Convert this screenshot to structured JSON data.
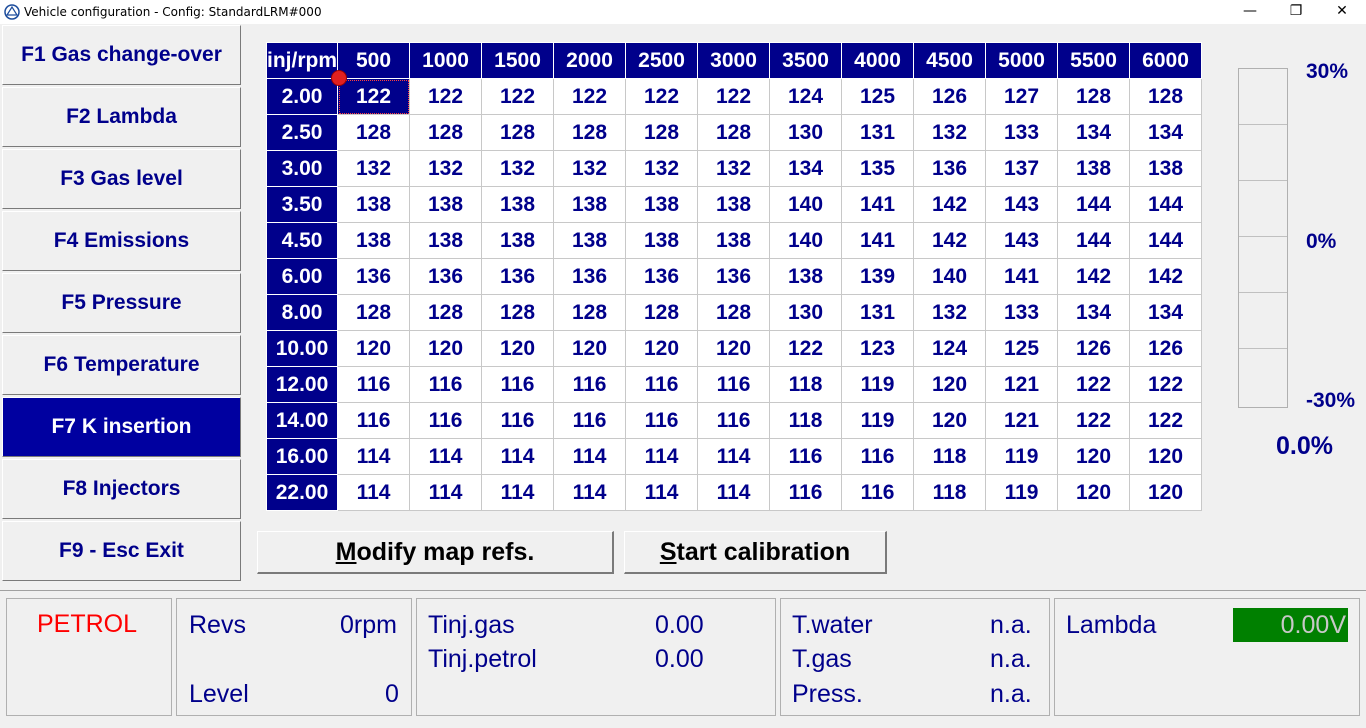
{
  "window": {
    "title": "Vehicle configuration - Config: StandardLRM#000",
    "minimize": "—",
    "maximize": "❐",
    "close": "✕"
  },
  "sidebar": {
    "items": [
      {
        "label": "F1 Gas change-over"
      },
      {
        "label": "F2 Lambda"
      },
      {
        "label": "F3 Gas level"
      },
      {
        "label": "F4 Emissions"
      },
      {
        "label": "F5 Pressure"
      },
      {
        "label": "F6 Temperature"
      },
      {
        "label": "F7 K insertion"
      },
      {
        "label": "F8 Injectors"
      },
      {
        "label": "F9 - Esc Exit"
      }
    ],
    "active_index": 6
  },
  "map": {
    "corner": "inj/rpm",
    "columns": [
      "500",
      "1000",
      "1500",
      "2000",
      "2500",
      "3000",
      "3500",
      "4000",
      "4500",
      "5000",
      "5500",
      "6000"
    ],
    "rows": [
      {
        "label": "2.00",
        "values": [
          "122",
          "122",
          "122",
          "122",
          "122",
          "122",
          "124",
          "125",
          "126",
          "127",
          "128",
          "128"
        ]
      },
      {
        "label": "2.50",
        "values": [
          "128",
          "128",
          "128",
          "128",
          "128",
          "128",
          "130",
          "131",
          "132",
          "133",
          "134",
          "134"
        ]
      },
      {
        "label": "3.00",
        "values": [
          "132",
          "132",
          "132",
          "132",
          "132",
          "132",
          "134",
          "135",
          "136",
          "137",
          "138",
          "138"
        ]
      },
      {
        "label": "3.50",
        "values": [
          "138",
          "138",
          "138",
          "138",
          "138",
          "138",
          "140",
          "141",
          "142",
          "143",
          "144",
          "144"
        ]
      },
      {
        "label": "4.50",
        "values": [
          "138",
          "138",
          "138",
          "138",
          "138",
          "138",
          "140",
          "141",
          "142",
          "143",
          "144",
          "144"
        ]
      },
      {
        "label": "6.00",
        "values": [
          "136",
          "136",
          "136",
          "136",
          "136",
          "136",
          "138",
          "139",
          "140",
          "141",
          "142",
          "142"
        ]
      },
      {
        "label": "8.00",
        "values": [
          "128",
          "128",
          "128",
          "128",
          "128",
          "128",
          "130",
          "131",
          "132",
          "133",
          "134",
          "134"
        ]
      },
      {
        "label": "10.00",
        "values": [
          "120",
          "120",
          "120",
          "120",
          "120",
          "120",
          "122",
          "123",
          "124",
          "125",
          "126",
          "126"
        ]
      },
      {
        "label": "12.00",
        "values": [
          "116",
          "116",
          "116",
          "116",
          "116",
          "116",
          "118",
          "119",
          "120",
          "121",
          "122",
          "122"
        ]
      },
      {
        "label": "14.00",
        "values": [
          "116",
          "116",
          "116",
          "116",
          "116",
          "116",
          "118",
          "119",
          "120",
          "121",
          "122",
          "122"
        ]
      },
      {
        "label": "16.00",
        "values": [
          "114",
          "114",
          "114",
          "114",
          "114",
          "114",
          "116",
          "116",
          "118",
          "119",
          "120",
          "120"
        ]
      },
      {
        "label": "22.00",
        "values": [
          "114",
          "114",
          "114",
          "114",
          "114",
          "114",
          "116",
          "116",
          "118",
          "119",
          "120",
          "120"
        ]
      }
    ],
    "selected": {
      "row": 0,
      "col": 0
    }
  },
  "gauge": {
    "top_label": "30%",
    "mid_label": "0%",
    "bottom_label": "-30%",
    "value": "0.0%"
  },
  "actions": {
    "modify_label_hotkey": "M",
    "modify_label_rest": "odify map refs.",
    "calib_label_hotkey": "S",
    "calib_label_rest": "tart calibration"
  },
  "status": {
    "fuel": "PETROL",
    "fuel_color": "#ff0000",
    "revs_label": "Revs",
    "revs_value": "0rpm",
    "level_label": "Level",
    "level_value": "0",
    "tinj_gas_label": "Tinj.gas",
    "tinj_gas_value": "0.00",
    "tinj_petrol_label": "Tinj.petrol",
    "tinj_petrol_value": "0.00",
    "twater_label": "T.water",
    "twater_value": "n.a.",
    "tgas_label": "T.gas",
    "tgas_value": "n.a.",
    "press_label": "Press.",
    "press_value": "n.a.",
    "lambda_label": "Lambda",
    "lambda_value": "0.00V"
  }
}
